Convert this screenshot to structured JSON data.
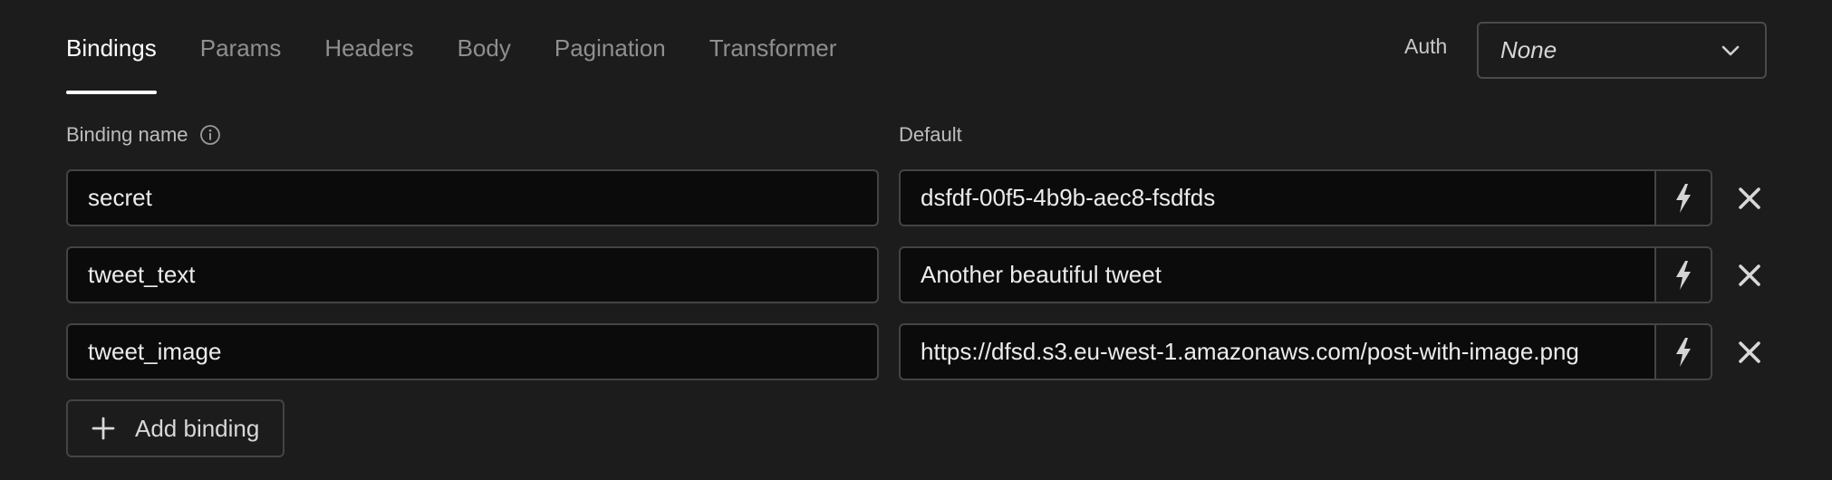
{
  "tabs": [
    {
      "label": "Bindings",
      "active": true
    },
    {
      "label": "Params"
    },
    {
      "label": "Headers"
    },
    {
      "label": "Body"
    },
    {
      "label": "Pagination"
    },
    {
      "label": "Transformer"
    }
  ],
  "auth": {
    "label": "Auth",
    "value": "None"
  },
  "columns": {
    "name": "Binding name",
    "default": "Default"
  },
  "bindings": [
    {
      "name": "secret",
      "default": "dsfdf-00f5-4b9b-aec8-fsdfds"
    },
    {
      "name": "tweet_text",
      "default": "Another beautiful tweet"
    },
    {
      "name": "tweet_image",
      "default": "https://dfsd.s3.eu-west-1.amazonaws.com/post-with-image.png"
    }
  ],
  "add_button": {
    "label": "Add binding"
  },
  "icons": {
    "info": "info-icon",
    "chevron": "chevron-down-icon",
    "bolt": "lightning-bolt-icon",
    "remove": "close-icon",
    "add": "plus-icon"
  },
  "colors": {
    "background": "#1c1c1c",
    "input_bg": "#0b0b0b",
    "border": "#444444",
    "active_tab": "#ffffff"
  }
}
